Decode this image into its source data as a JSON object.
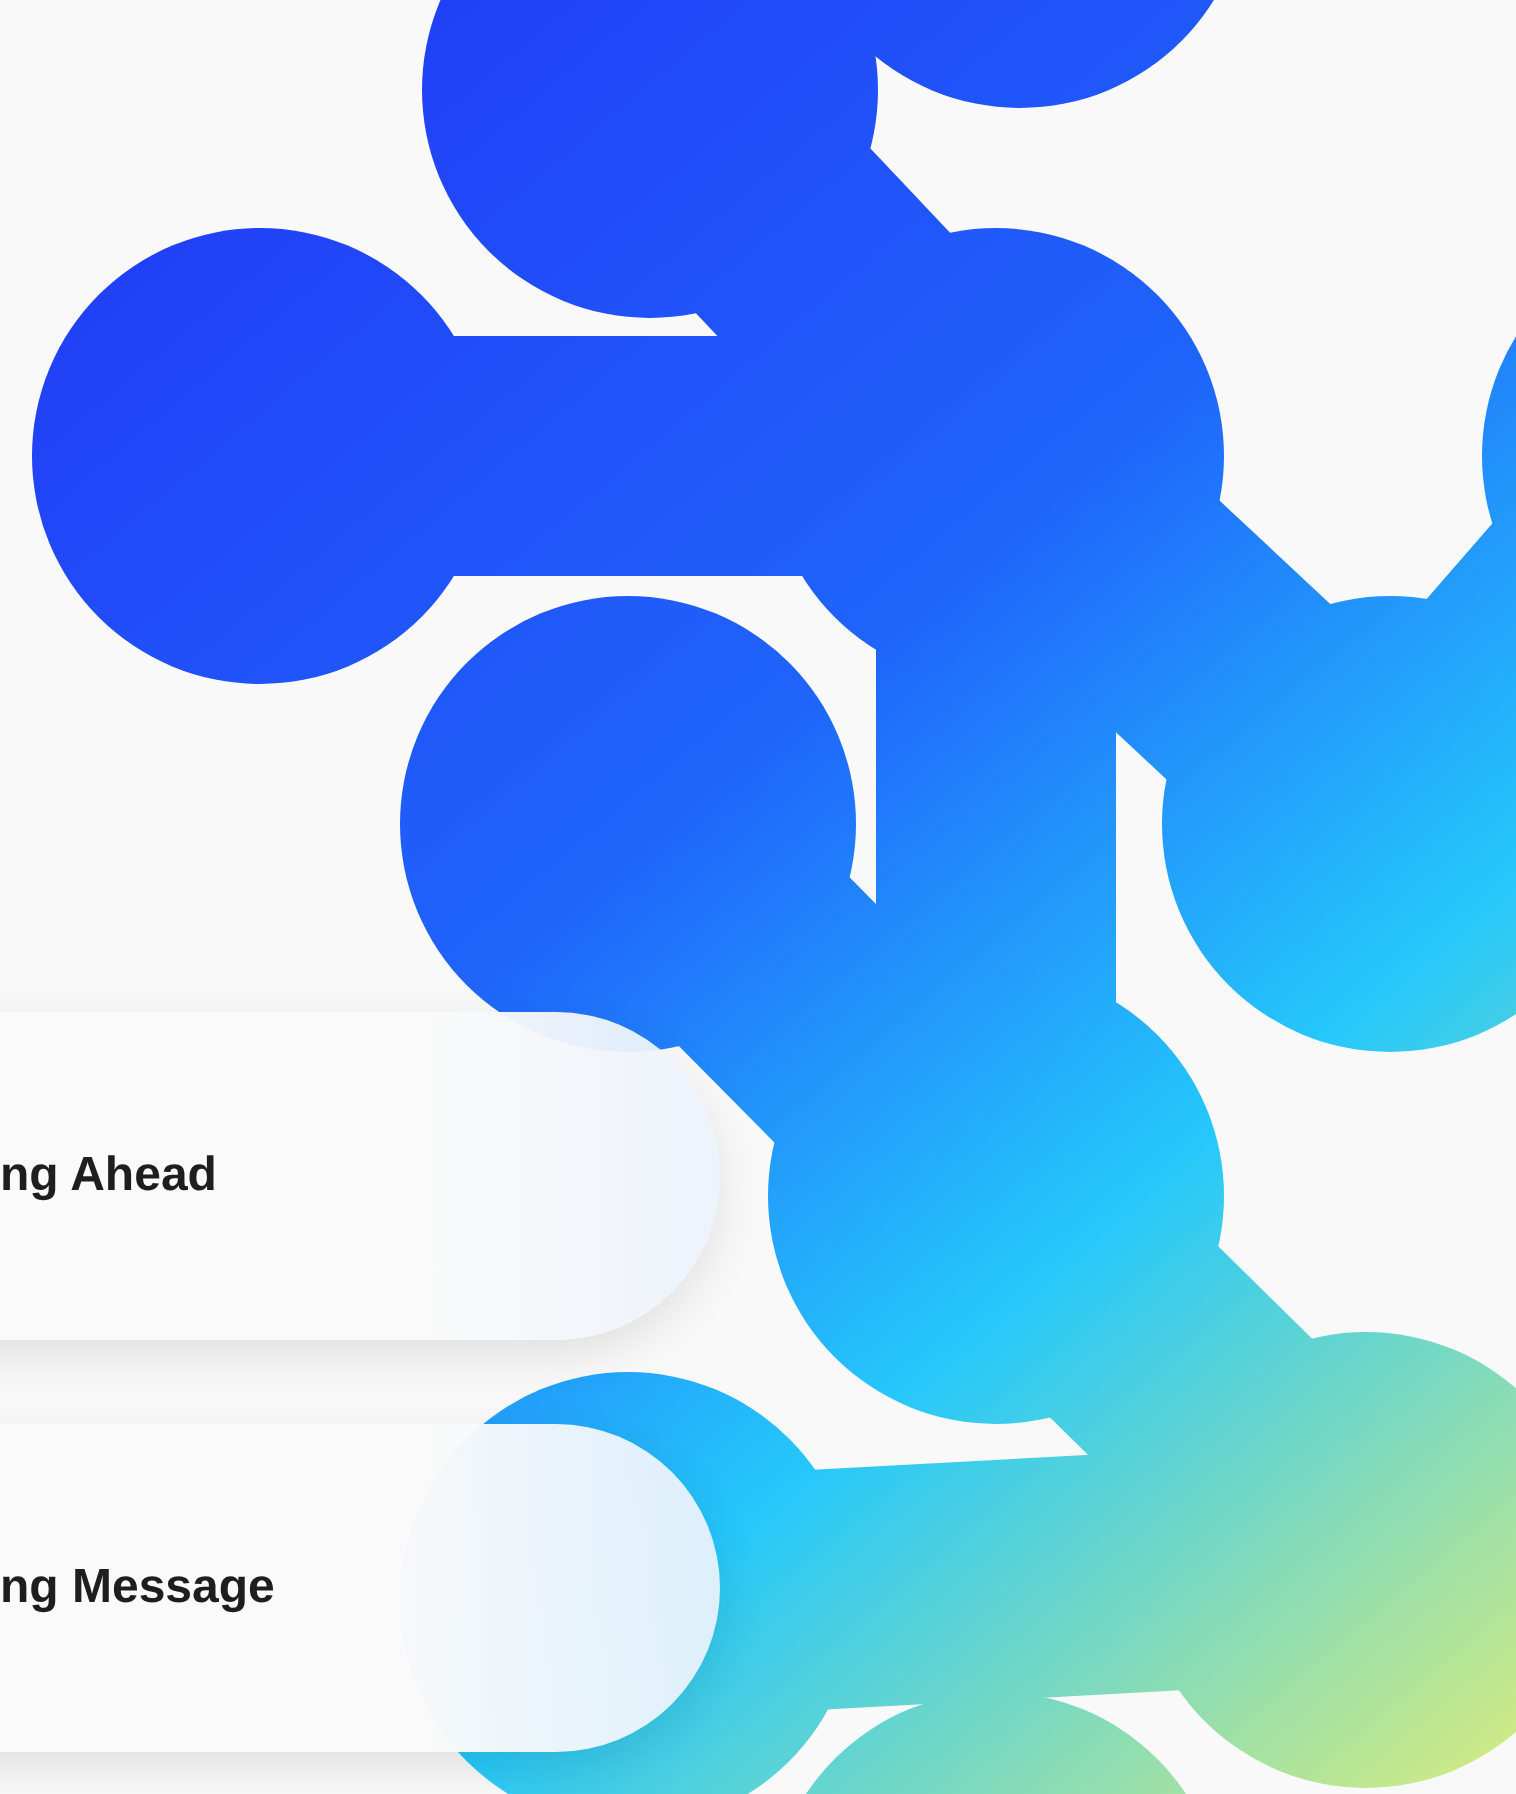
{
  "cards": [
    {
      "title": "ng Ahead"
    },
    {
      "title": "ng Message"
    }
  ]
}
